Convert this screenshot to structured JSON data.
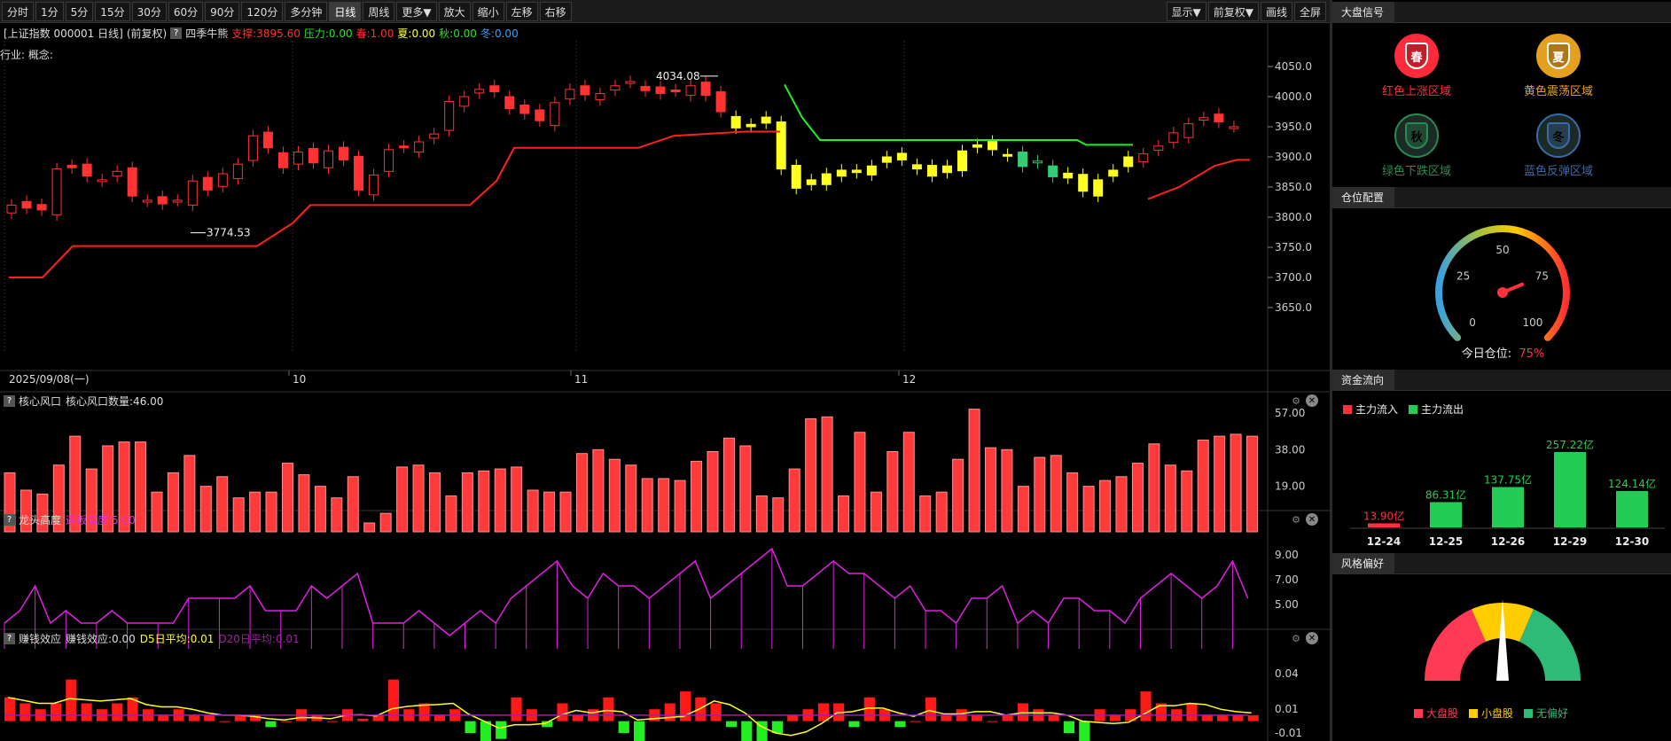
{
  "toolbar": {
    "periods": [
      "分时",
      "1分",
      "5分",
      "15分",
      "30分",
      "60分",
      "90分",
      "120分",
      "多分钟",
      "日线",
      "周线",
      "更多▼",
      "放大",
      "缩小",
      "左移",
      "右移"
    ],
    "active": "日线",
    "right": [
      "显示▼",
      "前复权▼",
      "画线",
      "全屏"
    ]
  },
  "infobar": {
    "index_name": "[上证指数 000001 日线]",
    "adjust": "(前复权)",
    "indicator": "四季牛熊",
    "support": "支撑:3895.60",
    "pressure": "压力:0.00",
    "spring": "春:1.00",
    "summer": "夏:0.00",
    "autumn": "秋:0.00",
    "winter": "冬:0.00"
  },
  "industry": "行业: 概念:",
  "main_chart": {
    "y_ticks": [
      "4050.0",
      "4000.0",
      "3950.0",
      "3900.0",
      "3850.0",
      "3800.0",
      "3750.0",
      "3700.0",
      "3650.0"
    ],
    "high_label": "4034.08",
    "low_label": "3774.53",
    "date_start": "2025/09/08(一)",
    "months": [
      "10",
      "11",
      "12"
    ]
  },
  "panel1": {
    "name": "核心风口",
    "value_label": "核心风口数量:46.00",
    "y_ticks": [
      "57.00",
      "38.00",
      "19.00"
    ]
  },
  "panel2": {
    "name": "龙头高度",
    "value_label": "连板高度:5.00",
    "y_ticks": [
      "9.00",
      "7.00",
      "5.00"
    ]
  },
  "panel3": {
    "name": "赚钱效应",
    "value_label": "赚钱效应:0.00",
    "d5": "D5日平均:0.01",
    "d20": "D20日平均:0.01",
    "y_ticks": [
      "0.04",
      "0.01",
      "-0.01"
    ]
  },
  "right_panel": {
    "signal_title": "大盘信号",
    "signals": [
      {
        "char": "春",
        "label": "红色上涨区域",
        "color": "#ff2a3a"
      },
      {
        "char": "夏",
        "label": "黄色震荡区域",
        "color": "#e6a020"
      },
      {
        "char": "秋",
        "label": "绿色下跌区域",
        "color": "#2a8a55"
      },
      {
        "char": "冬",
        "label": "蓝色反弹区域",
        "color": "#3a6aa8"
      }
    ],
    "position_title": "仓位配置",
    "gauge_ticks": [
      "0",
      "25",
      "50",
      "75",
      "100"
    ],
    "gauge_value": 75,
    "today_label": "今日仓位:",
    "today_value": "75%",
    "flow_title": "资金流向",
    "flow_legend_in": "主力流入",
    "flow_legend_out": "主力流出",
    "flow": [
      {
        "date": "12-24",
        "value": "13.90亿",
        "amount": 13.9,
        "dir": "in"
      },
      {
        "date": "12-25",
        "value": "86.31亿",
        "amount": 86.31,
        "dir": "out"
      },
      {
        "date": "12-26",
        "value": "137.75亿",
        "amount": 137.75,
        "dir": "out"
      },
      {
        "date": "12-29",
        "value": "257.22亿",
        "amount": 257.22,
        "dir": "out"
      },
      {
        "date": "12-30",
        "value": "124.14亿",
        "amount": 124.14,
        "dir": "out"
      }
    ],
    "style_title": "风格偏好",
    "style_legend": [
      "大盘股",
      "小盘股",
      "无偏好"
    ],
    "style_value": "小盘股"
  }
}
